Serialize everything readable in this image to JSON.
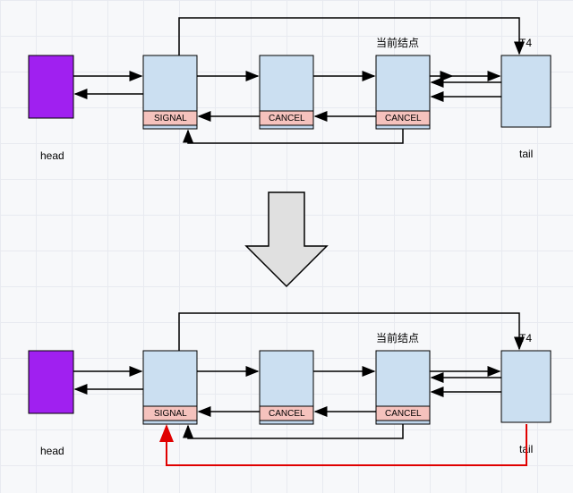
{
  "colors": {
    "head_fill": "#a020f0",
    "node_fill": "#cbdff1",
    "status_fill": "#f5c2bd",
    "grid": "#e8eaf0",
    "red_arrow": "#e00000"
  },
  "labels": {
    "head": "head",
    "tail": "tail",
    "current_node": "当前结点",
    "t4": "T4"
  },
  "statuses": {
    "signal": "SIGNAL",
    "cancel": "CANCEL"
  },
  "top": {
    "nodes": [
      {
        "id": "head",
        "kind": "head",
        "label_key": "labels.head"
      },
      {
        "id": "n1",
        "kind": "node",
        "status_key": "statuses.signal"
      },
      {
        "id": "n2",
        "kind": "node",
        "status_key": "statuses.cancel"
      },
      {
        "id": "n3",
        "kind": "node",
        "status_key": "statuses.cancel",
        "top_label_key": "labels.current_node"
      },
      {
        "id": "t4",
        "kind": "node",
        "top_label_key": "labels.t4",
        "bottom_label_key": "labels.tail"
      }
    ]
  },
  "bottom": {
    "nodes": [
      {
        "id": "head",
        "kind": "head",
        "label_key": "labels.head"
      },
      {
        "id": "n1",
        "kind": "node",
        "status_key": "statuses.signal"
      },
      {
        "id": "n2",
        "kind": "node",
        "status_key": "statuses.cancel"
      },
      {
        "id": "n3",
        "kind": "node",
        "status_key": "statuses.cancel",
        "top_label_key": "labels.current_node"
      },
      {
        "id": "t4",
        "kind": "node",
        "top_label_key": "labels.t4",
        "bottom_label_key": "labels.tail"
      }
    ],
    "red_arrow": {
      "from": "t4",
      "to": "n1"
    }
  }
}
